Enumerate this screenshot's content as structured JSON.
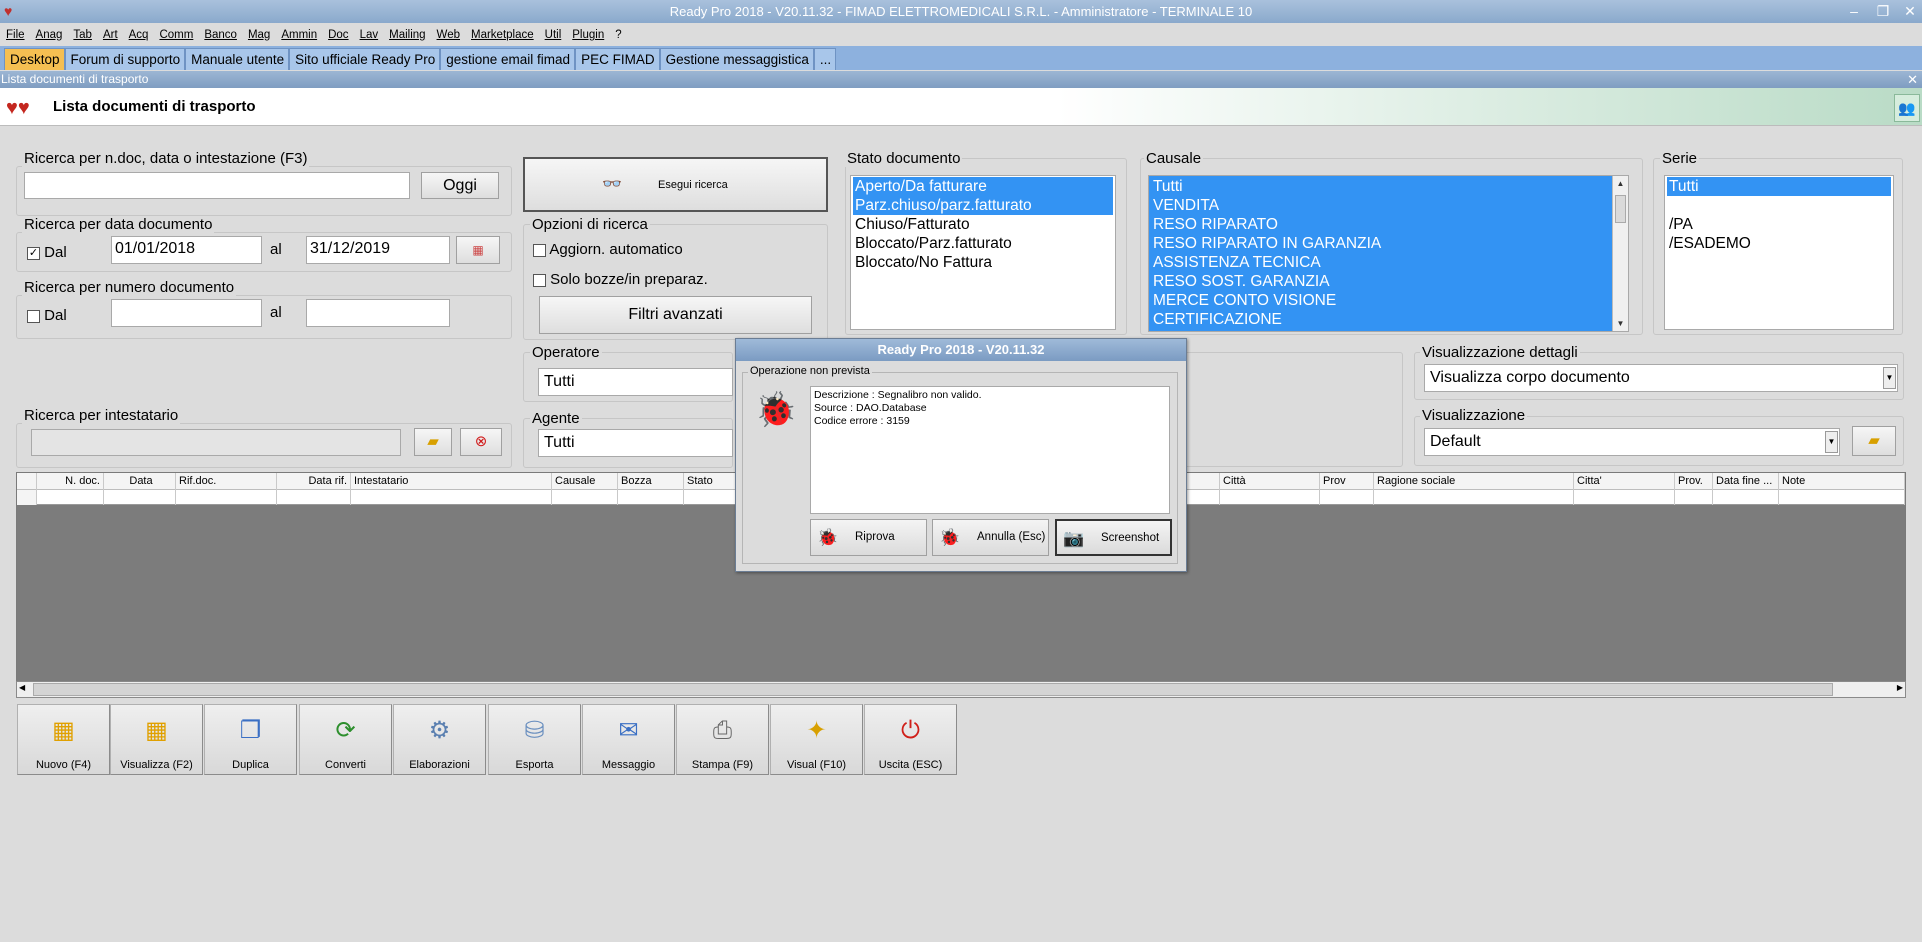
{
  "window": {
    "title": "Ready Pro 2018 - V20.11.32 - FIMAD ELETTROMEDICALI S.R.L. - Amministratore - TERMINALE 10",
    "minimize": "–",
    "restore": "❐",
    "close": "✕"
  },
  "menu": [
    "File",
    "Anag",
    "Tab",
    "Art",
    "Acq",
    "Comm",
    "Banco",
    "Mag",
    "Ammin",
    "Doc",
    "Lav",
    "Mailing",
    "Web",
    "Marketplace",
    "Util",
    "Plugin",
    "?"
  ],
  "tabs": [
    "Desktop",
    "Forum di supporto",
    "Manuale utente",
    "Sito ufficiale Ready Pro",
    "gestione email fimad",
    "PEC FIMAD",
    "Gestione messaggistica",
    "..."
  ],
  "subwindow": {
    "title": "Lista documenti di trasporto",
    "close": "✕",
    "header_title": "Lista documenti di trasporto"
  },
  "search": {
    "ricerca_label": "Ricerca per n.doc, data o intestazione (F3)",
    "ricerca_value": "",
    "oggi_label": "Oggi",
    "esegui_label": "Esegui ricerca",
    "data_doc_label": "Ricerca per data documento",
    "dal_label": "Dal",
    "dal_checked": true,
    "date_from": "01/01/2018",
    "al_label": "al",
    "date_to": "31/12/2019",
    "num_doc_label": "Ricerca per numero documento",
    "num_dal_label": "Dal",
    "num_dal_checked": false,
    "num_al_label": "al",
    "num_from": "",
    "num_to": "",
    "intestatario_label": "Ricerca per intestatario",
    "intestatario_value": ""
  },
  "options": {
    "label": "Opzioni di ricerca",
    "aggiorn": "Aggiorn. automatico",
    "aggiorn_checked": false,
    "bozze": "Solo bozze/in preparaz.",
    "bozze_checked": false,
    "filtri": "Filtri avanzati"
  },
  "operatore": {
    "label": "Operatore",
    "value": "Tutti"
  },
  "agente": {
    "label": "Agente",
    "value": "Tutti"
  },
  "stato": {
    "label": "Stato documento",
    "items": [
      {
        "text": "Aperto/Da fatturare",
        "selected": true
      },
      {
        "text": "Parz.chiuso/parz.fatturato",
        "selected": true
      },
      {
        "text": "Chiuso/Fatturato",
        "selected": false
      },
      {
        "text": "Bloccato/Parz.fatturato",
        "selected": false
      },
      {
        "text": "Bloccato/No Fattura",
        "selected": false
      }
    ]
  },
  "causale": {
    "label": "Causale",
    "items": [
      "Tutti",
      "VENDITA",
      "RESO RIPARATO",
      "RESO RIPARATO IN GARANZIA",
      "ASSISTENZA TECNICA",
      "RESO SOST. GARANZIA",
      "MERCE CONTO VISIONE",
      "CERTIFICAZIONE"
    ]
  },
  "serie": {
    "label": "Serie",
    "items": [
      {
        "text": "Tutti",
        "selected": true
      },
      {
        "text": "",
        "selected": false
      },
      {
        "text": "/PA",
        "selected": false
      },
      {
        "text": "/ESADEMO",
        "selected": false
      }
    ]
  },
  "vis_dettagli": {
    "label": "Visualizzazione dettagli",
    "value": "Visualizza corpo documento"
  },
  "visualizzazione": {
    "label": "Visualizzazione",
    "value": "Default"
  },
  "grid": {
    "columns": [
      "",
      "N. doc.",
      "Data",
      "Rif.doc.",
      "Data rif.",
      "Intestatario",
      "Causale",
      "Bozza",
      "Stato",
      "",
      "Città",
      "Prov",
      "Ragione sociale",
      "Citta'",
      "Prov.",
      "Data fine ...",
      "Note"
    ]
  },
  "toolbar": [
    {
      "label": "Nuovo (F4)",
      "icon": "new-doc-icon",
      "glyph": "▦"
    },
    {
      "label": "Visualizza (F2)",
      "icon": "view-icon",
      "glyph": "▦"
    },
    {
      "label": "Duplica",
      "icon": "duplicate-icon",
      "glyph": "❐"
    },
    {
      "label": "Converti",
      "icon": "convert-icon",
      "glyph": "⟳"
    },
    {
      "label": "Elaborazioni",
      "icon": "process-icon",
      "glyph": "⚙"
    },
    {
      "label": "Esporta",
      "icon": "export-icon",
      "glyph": "⛁"
    },
    {
      "label": "Messaggio",
      "icon": "message-icon",
      "glyph": "✉"
    },
    {
      "label": "Stampa (F9)",
      "icon": "print-icon",
      "glyph": "⎙"
    },
    {
      "label": "Visual (F10)",
      "icon": "magic-wand-icon",
      "glyph": "✦"
    },
    {
      "label": "Uscita (ESC)",
      "icon": "exit-icon",
      "glyph": "⏻"
    }
  ],
  "modal": {
    "title": "Ready Pro 2018 - V20.11.32",
    "group_label": "Operazione non prevista",
    "lines": [
      "Descrizione : Segnalibro non valido.",
      "Source : DAO.Database",
      "Codice errore : 3159"
    ],
    "riprova": "Riprova",
    "annulla": "Annulla (Esc)",
    "screenshot": "Screenshot"
  },
  "colors": {
    "accent": "#3393f3",
    "tab_active": "#f5bf52",
    "tab_bar": "#8db1de"
  }
}
